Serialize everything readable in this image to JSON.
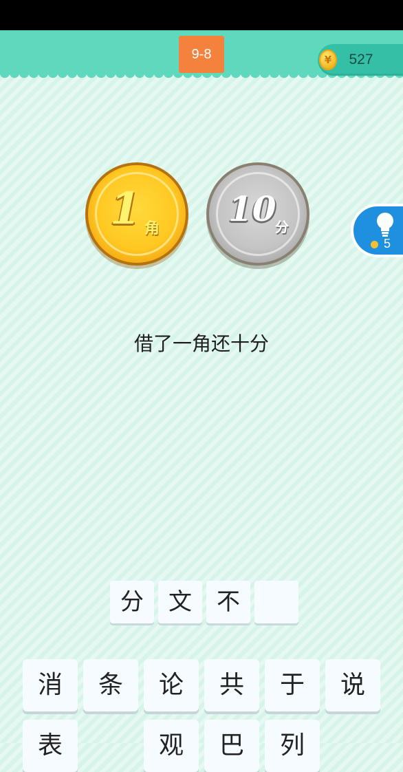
{
  "level": "9-8",
  "coins": "527",
  "hint_count": "5",
  "gold_coin": {
    "number": "1",
    "unit": "角"
  },
  "silver_coin": {
    "number": "10",
    "unit": "分"
  },
  "clue": "借了一角还十分",
  "answer_slots": [
    "分",
    "文",
    "不",
    ""
  ],
  "keyboard_row1": [
    "消",
    "条",
    "论",
    "共",
    "于",
    "说"
  ],
  "keyboard_row2": [
    "表",
    "",
    "观",
    "巴",
    "列",
    ""
  ],
  "colors": {
    "header": "#5fd9bd",
    "level_badge": "#f5823c",
    "hint_button": "#1f8fe0",
    "background": "#d7f4e9"
  },
  "icons": {
    "coin": "gold-coin-icon",
    "hint": "lightbulb-icon"
  }
}
